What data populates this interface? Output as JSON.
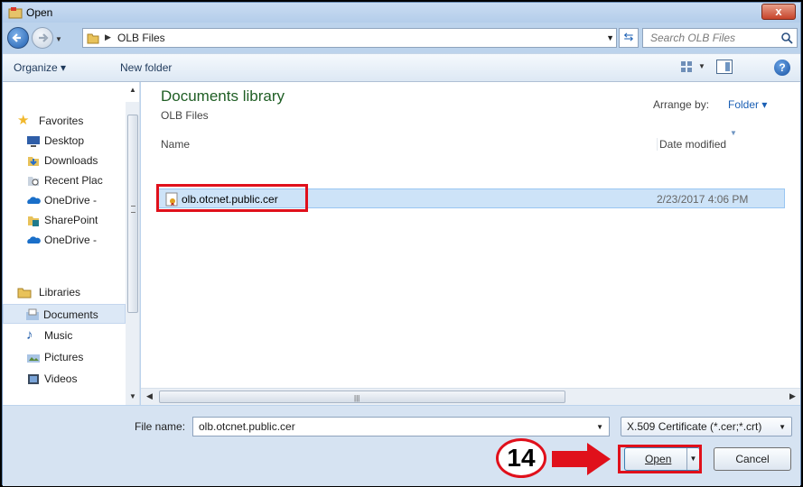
{
  "window": {
    "title": "Open",
    "close_label": "x"
  },
  "address": {
    "path_label": "OLB Files",
    "search_placeholder": "Search OLB Files"
  },
  "toolbar": {
    "organize_label": "Organize ▾",
    "new_folder_label": "New folder"
  },
  "sidebar": {
    "items": [
      {
        "label": "Favorites",
        "icon": "star-icon"
      },
      {
        "label": "Desktop",
        "icon": "desktop-icon"
      },
      {
        "label": "Downloads",
        "icon": "downloads-icon"
      },
      {
        "label": "Recent Plac",
        "icon": "recent-places-icon"
      },
      {
        "label": "OneDrive -",
        "icon": "onedrive-icon"
      },
      {
        "label": "SharePoint",
        "icon": "sharepoint-icon"
      },
      {
        "label": "OneDrive -",
        "icon": "onedrive-icon"
      },
      {
        "label": "Libraries",
        "icon": "libraries-icon"
      },
      {
        "label": "Documents",
        "icon": "documents-icon",
        "selected": true
      },
      {
        "label": "Music",
        "icon": "music-icon"
      },
      {
        "label": "Pictures",
        "icon": "pictures-icon"
      },
      {
        "label": "Videos",
        "icon": "videos-icon"
      }
    ]
  },
  "main": {
    "library_title": "Documents library",
    "library_subtitle": "OLB Files",
    "arrange_label": "Arrange by:",
    "arrange_value": "Folder ▾",
    "columns": {
      "name": "Name",
      "date": "Date modified"
    },
    "files": [
      {
        "name": "olb.otcnet.public.cer",
        "date": "2/23/2017 4:06 PM"
      }
    ]
  },
  "bottom": {
    "file_name_label": "File name:",
    "file_name_value": "olb.otcnet.public.cer",
    "filter_value": "X.509 Certificate (*.cer;*.crt)",
    "open_label": "Open",
    "cancel_label": "Cancel"
  },
  "annotation": {
    "step_number": "14"
  },
  "colors": {
    "highlight": "#e0101b",
    "library_title": "#1f5e24",
    "selection": "#cde3f8"
  }
}
